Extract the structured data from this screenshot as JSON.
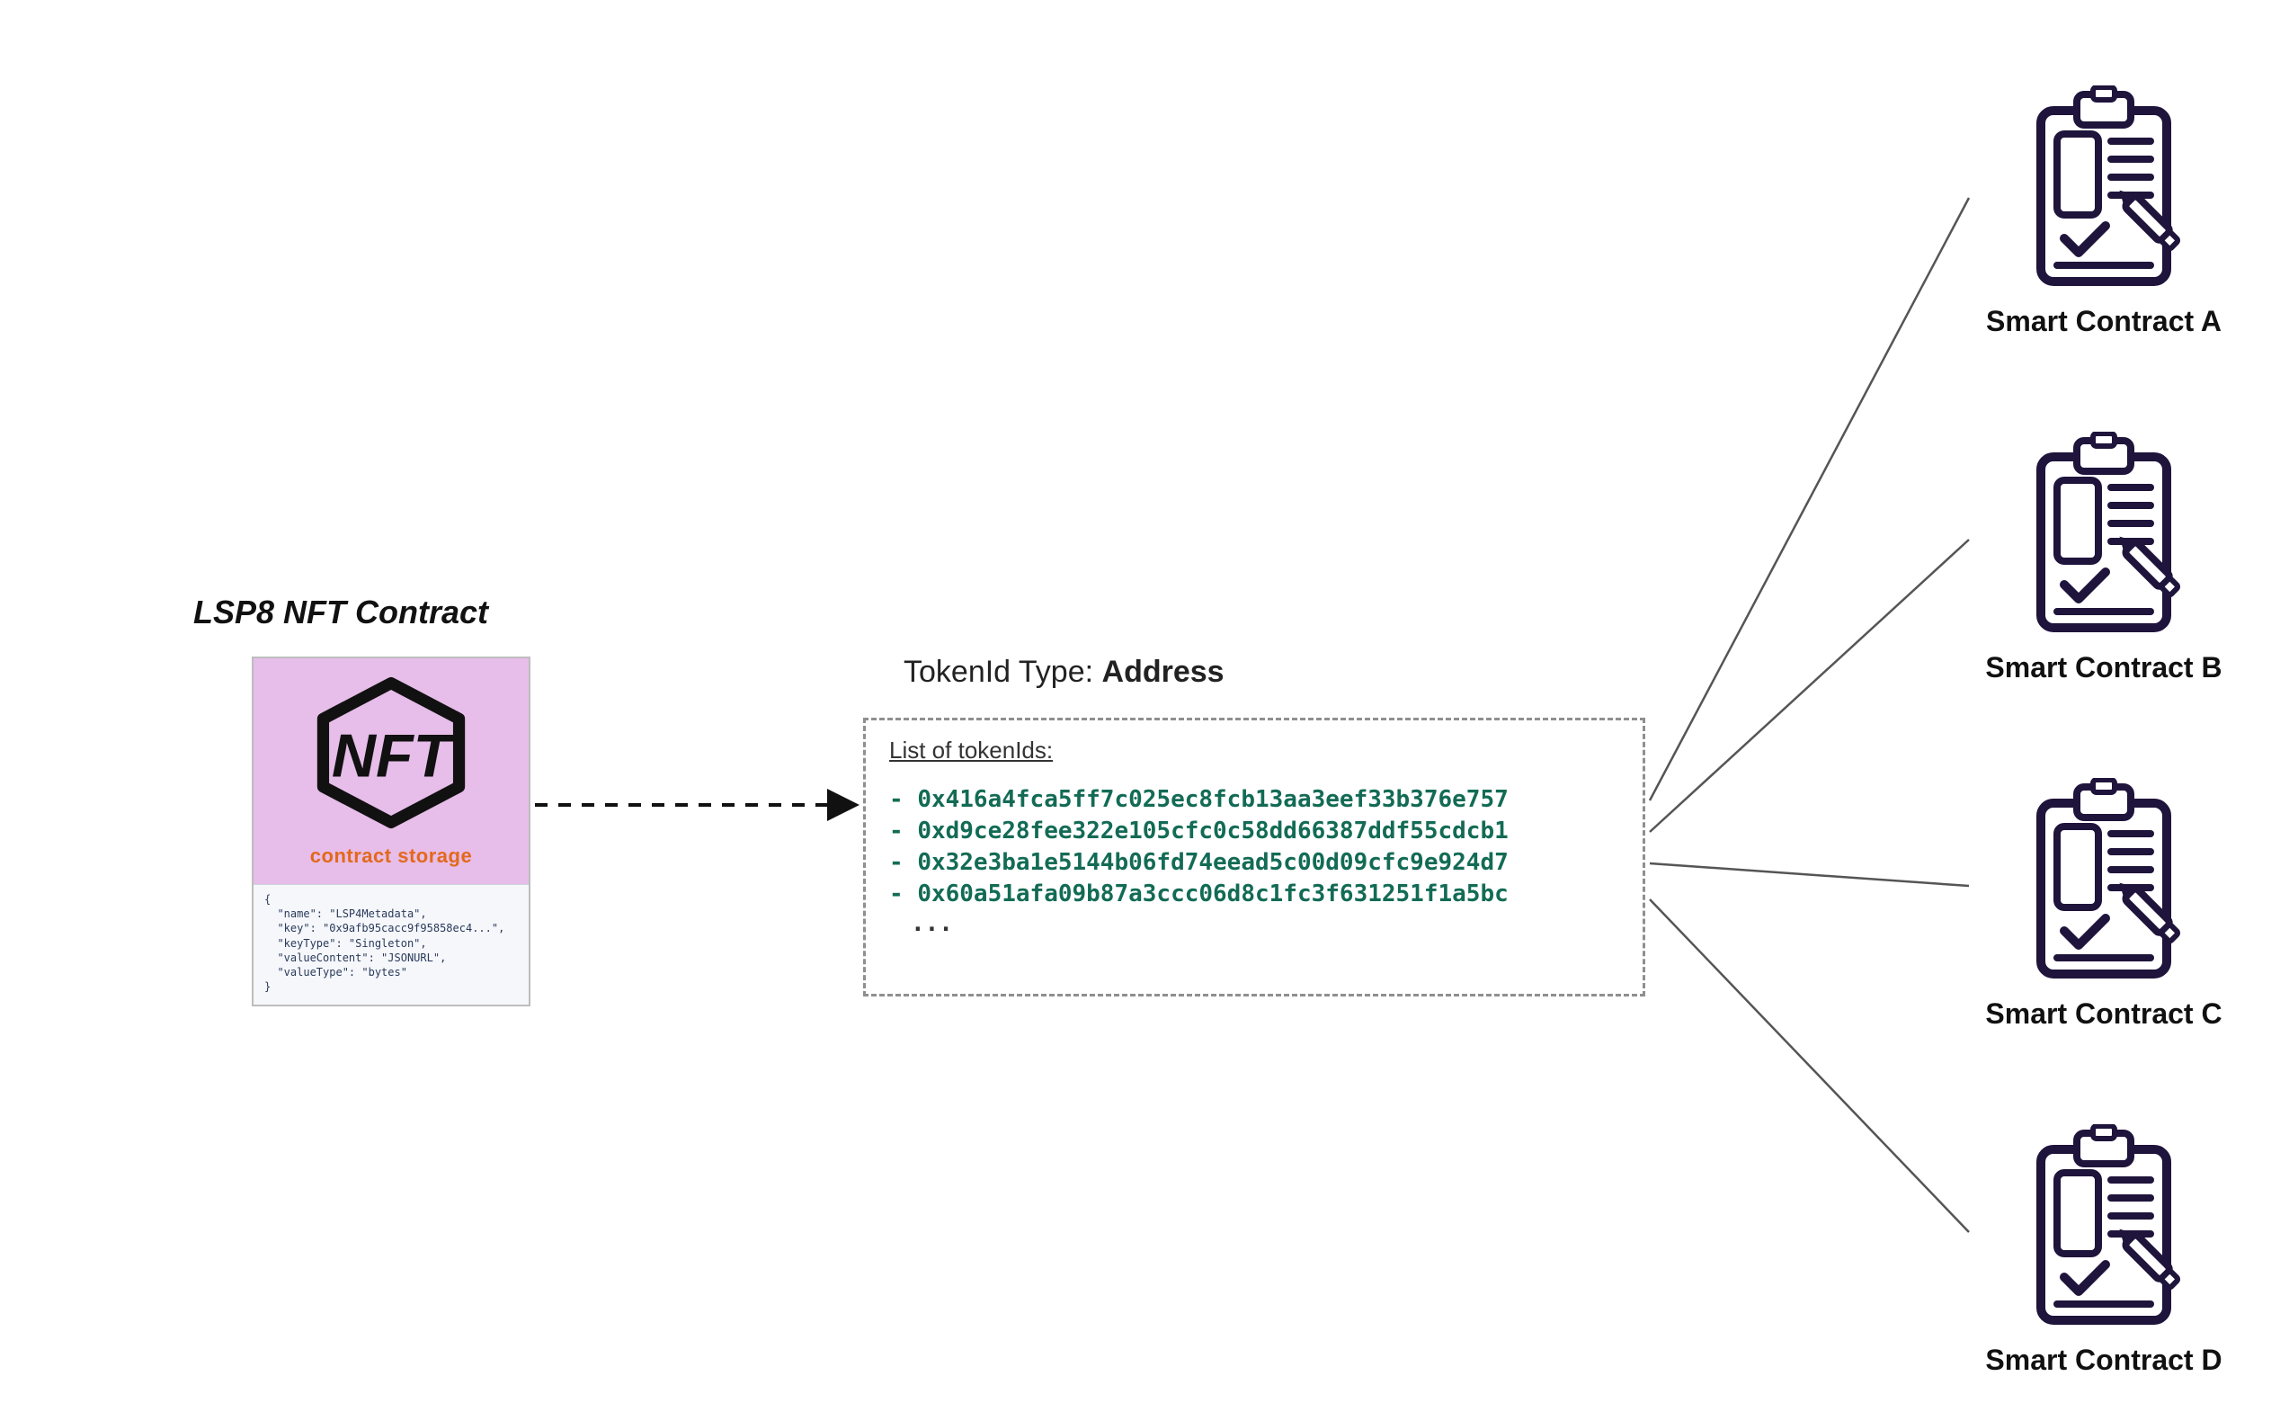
{
  "nft": {
    "title": "LSP8 NFT Contract",
    "storage_label": "contract storage",
    "metadata_json": "{\n  \"name\": \"LSP4Metadata\",\n  \"key\": \"0x9afb95cacc9f95858ec4...\",\n  \"keyType\": \"Singleton\",\n  \"valueContent\": \"JSONURL\",\n  \"valueType\": \"bytes\"\n}"
  },
  "tokenid": {
    "title_prefix": "TokenId Type: ",
    "title_bold": "Address",
    "list_label": "List of tokenIds:",
    "ids": [
      "0x416a4fca5ff7c025ec8fcb13aa3eef33b376e757",
      "0xd9ce28fee322e105cfc0c58dd66387ddf55cdcb1",
      "0x32e3ba1e5144b06fd74eead5c00d09cfc9e924d7",
      "0x60a51afa09b87a3ccc06d8c1fc3f631251f1a5bc"
    ],
    "ellipsis": "..."
  },
  "contracts": [
    {
      "label": "Smart Contract A"
    },
    {
      "label": "Smart Contract B"
    },
    {
      "label": "Smart Contract C"
    },
    {
      "label": "Smart Contract D"
    }
  ],
  "colors": {
    "card_header": "#e7bde9",
    "clipboard_stroke": "#1f143b",
    "token_green": "#136b55",
    "storage_orange": "#e2691b"
  }
}
